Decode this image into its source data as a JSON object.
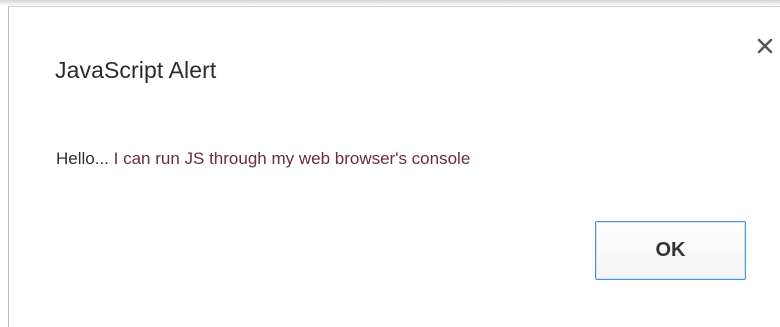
{
  "dialog": {
    "title": "JavaScript Alert",
    "message_prefix": "Hello... ",
    "message_body": "I can run JS through my web browser's console",
    "ok_label": "OK",
    "close_icon": "close-icon"
  },
  "colors": {
    "button_border": "#4a90e2",
    "title_text": "#2b2b2b",
    "message_accent": "#6a2d3a"
  }
}
